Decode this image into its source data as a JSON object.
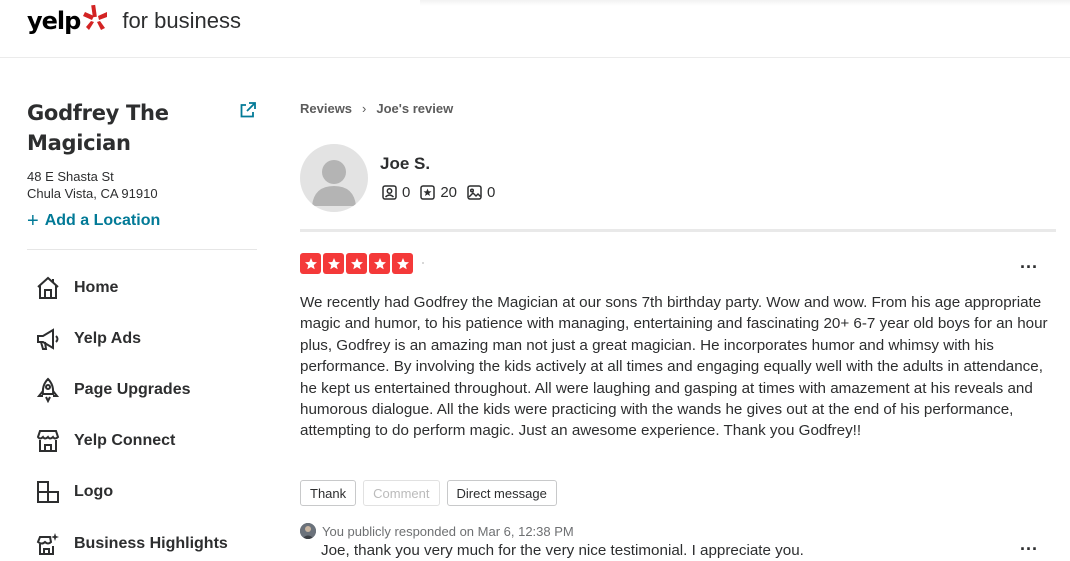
{
  "header": {
    "logo_text": "yelp",
    "logo_suffix": "for business",
    "brand_color": "#d32323"
  },
  "business": {
    "name": "Godfrey The Magician",
    "address_line1": "48 E Shasta St",
    "address_line2": "Chula Vista, CA 91910",
    "add_location_label": "Add a Location",
    "link_color": "#027a97"
  },
  "sidebar": {
    "items": [
      {
        "label": "Home",
        "icon": "home-icon"
      },
      {
        "label": "Yelp Ads",
        "icon": "megaphone-icon"
      },
      {
        "label": "Page Upgrades",
        "icon": "rocket-icon"
      },
      {
        "label": "Yelp Connect",
        "icon": "storefront-icon"
      },
      {
        "label": "Logo",
        "icon": "logo-grid-icon"
      },
      {
        "label": "Business Highlights",
        "icon": "highlight-store-icon"
      }
    ]
  },
  "breadcrumb": {
    "parent": "Reviews",
    "separator": "›",
    "current": "Joe's review"
  },
  "reviewer": {
    "name": "Joe S.",
    "friends_count": "0",
    "reviews_count": "20",
    "photos_count": "0"
  },
  "review": {
    "rating": 5,
    "star_color": "#f43939",
    "text": "We recently had Godfrey the Magician at our sons 7th birthday party. Wow and wow. From his age appropriate magic and humor, to his patience with managing, entertaining and fascinating 20+ 6-7 year old boys for an hour plus, Godfrey is an amazing man not just a great magician. He incorporates humor and whimsy with his performance. By involving the kids actively at all times and engaging equally well with the adults in attendance, he kept us entertained throughout. All were laughing and gasping at times with amazement at his reveals and humorous dialogue. All the kids were practicing with the wands he gives out at the end of his performance, attempting to do perform magic. Just an awesome experience. Thank you Godfrey!!",
    "more_label": "...",
    "actions": {
      "thank": "Thank",
      "comment": "Comment",
      "direct_message": "Direct message"
    }
  },
  "response": {
    "meta": "You publicly responded on Mar 6, 12:38 PM",
    "text": "Joe, thank you very much for the very nice testimonial. I appreciate you.",
    "more_label": "..."
  }
}
